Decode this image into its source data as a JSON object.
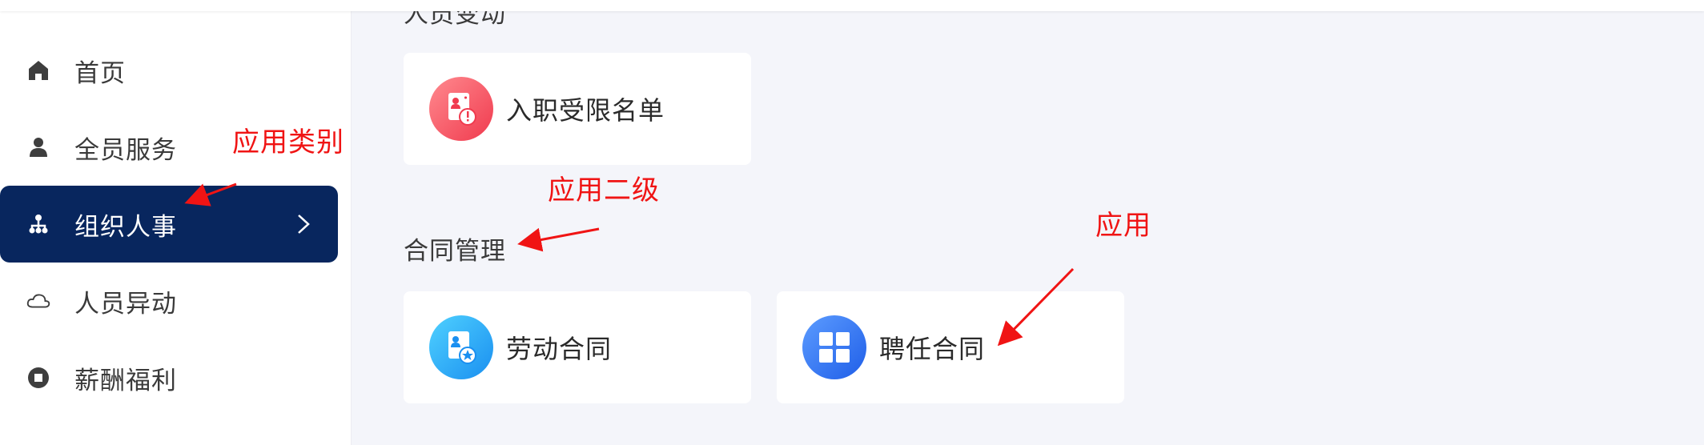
{
  "sidebar": {
    "items": [
      {
        "label": "首页",
        "icon": "home-icon"
      },
      {
        "label": "全员服务",
        "icon": "user-icon"
      },
      {
        "label": "组织人事",
        "icon": "org-chart-icon",
        "active": true
      },
      {
        "label": "人员异动",
        "icon": "cloud-icon"
      },
      {
        "label": "薪酬福利",
        "icon": "record-icon"
      }
    ],
    "partial_item_label": "",
    "active_color": "#08265e"
  },
  "main": {
    "partial_section_title": "人员变动",
    "sections": [
      {
        "title": "",
        "apps": [
          {
            "label": "入职受限名单",
            "icon": "restricted-list-icon"
          }
        ]
      },
      {
        "title": "合同管理",
        "apps": [
          {
            "label": "劳动合同",
            "icon": "labor-contract-icon"
          },
          {
            "label": "聘任合同",
            "icon": "grid-apps-icon"
          }
        ]
      }
    ]
  },
  "annotations": {
    "category": "应用类别",
    "secondary": "应用二级",
    "app": "应用",
    "color": "#f01414"
  }
}
